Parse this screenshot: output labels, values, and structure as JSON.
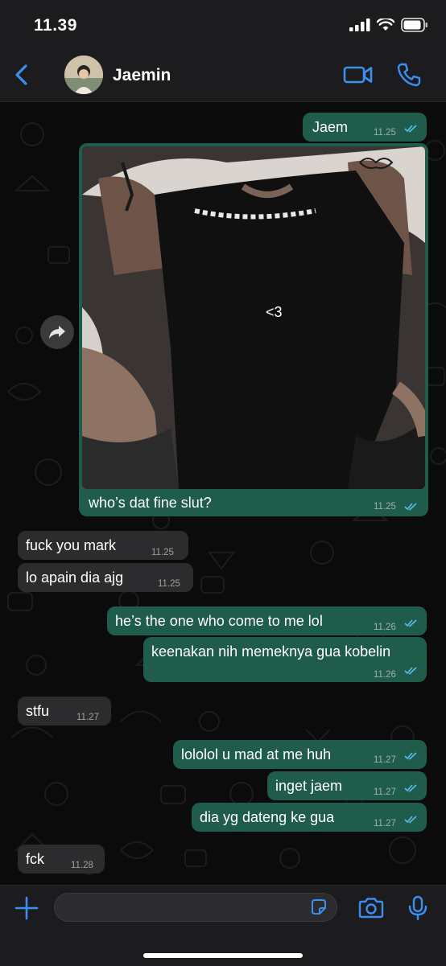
{
  "status_bar": {
    "time": "11.39",
    "icons": [
      "signal-icon",
      "wifi-icon",
      "battery-icon"
    ]
  },
  "header": {
    "contact_name": "Jaemin",
    "icons": [
      "back-chevron-icon",
      "video-call-icon",
      "phone-call-icon"
    ]
  },
  "colors": {
    "outgoing": "#1f5c4b",
    "incoming": "#2c2c2e",
    "accent": "#3a8ff0",
    "read_ticks": "#53bdeb"
  },
  "photo_message": {
    "overlay_text": "<3",
    "caption": "who’s dat fine slut?",
    "time": "11.25"
  },
  "messages": [
    {
      "dir": "out",
      "text": "Jaem",
      "time": "11.25"
    },
    {
      "dir": "in",
      "text": "fuck you mark",
      "time": "11.25"
    },
    {
      "dir": "in",
      "text": "lo apain dia ajg",
      "time": "11.25"
    },
    {
      "dir": "out",
      "text": "he’s the one who come to me lol",
      "time": "11.26"
    },
    {
      "dir": "out",
      "text": "keenakan nih memeknya gua kobelin",
      "time": "11.26"
    },
    {
      "dir": "in",
      "text": "stfu",
      "time": "11.27"
    },
    {
      "dir": "out",
      "text": "lololol u mad at me huh",
      "time": "11.27"
    },
    {
      "dir": "out",
      "text": "inget jaem",
      "time": "11.27"
    },
    {
      "dir": "out",
      "text": "dia yg dateng ke gua",
      "time": "11.27"
    },
    {
      "dir": "in",
      "text": "fck",
      "time": "11.28"
    }
  ],
  "composer": {
    "placeholder": "",
    "icons": [
      "plus-icon",
      "sticker-icon",
      "camera-icon",
      "microphone-icon"
    ]
  }
}
